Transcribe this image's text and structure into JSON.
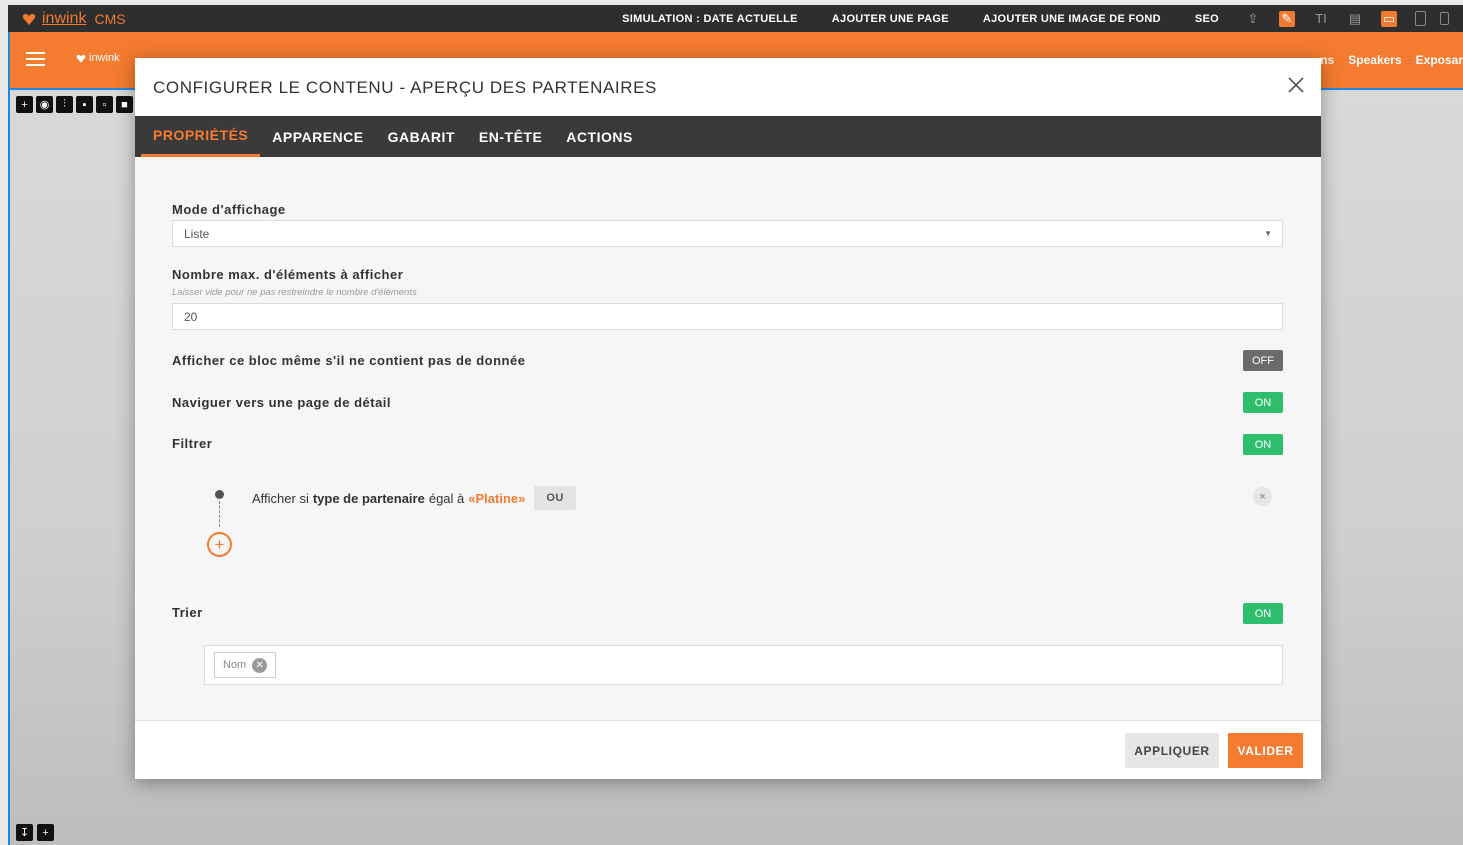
{
  "cms": {
    "brand": "inwink",
    "product": "CMS",
    "actions": [
      "SIMULATION : DATE ACTUELLE",
      "AJOUTER UNE PAGE",
      "AJOUTER UNE IMAGE DE FOND",
      "SEO"
    ],
    "icons": [
      "share-icon",
      "edit-icon",
      "text-icon",
      "layout-icon",
      "desktop-icon",
      "tablet-icon",
      "mobile-icon"
    ]
  },
  "site": {
    "brand": "inwink",
    "nav": [
      "ns",
      "Speakers",
      "Exposar"
    ]
  },
  "modal": {
    "title": "CONFIGURER LE CONTENU - APERÇU DES PARTENAIRES",
    "tabs": [
      "PROPRIÉTÉS",
      "APPARENCE",
      "GABARIT",
      "EN-TÊTE",
      "ACTIONS"
    ],
    "active_tab": "PROPRIÉTÉS"
  },
  "form": {
    "display_mode": {
      "label": "Mode d'affichage",
      "value": "Liste"
    },
    "max_items": {
      "label": "Nombre max. d'éléments à afficher",
      "hint": "Laisser vide pour ne pas restreindre le nombre d'éléments",
      "value": "20"
    },
    "show_empty": {
      "label": "Afficher ce bloc même s'il ne contient pas de donnée",
      "state": "OFF"
    },
    "navigate_detail": {
      "label": "Naviguer vers une page de détail",
      "state": "ON"
    },
    "filter": {
      "label": "Filtrer",
      "state": "ON",
      "rule_prefix": "Afficher si",
      "rule_field": "type de partenaire",
      "rule_operator": "égal à",
      "rule_value": "«Platine»",
      "or_label": "OU",
      "remove_label": "×",
      "add_label": "+"
    },
    "sort": {
      "label": "Trier",
      "state": "ON",
      "tags": [
        "Nom"
      ]
    }
  },
  "footer": {
    "apply_label": "APPLIQUER",
    "validate_label": "VALIDER"
  },
  "colors": {
    "accent": "#f47b30",
    "on": "#2fbe6e",
    "off": "#6b6b6b",
    "dark": "#3a3a3a"
  }
}
